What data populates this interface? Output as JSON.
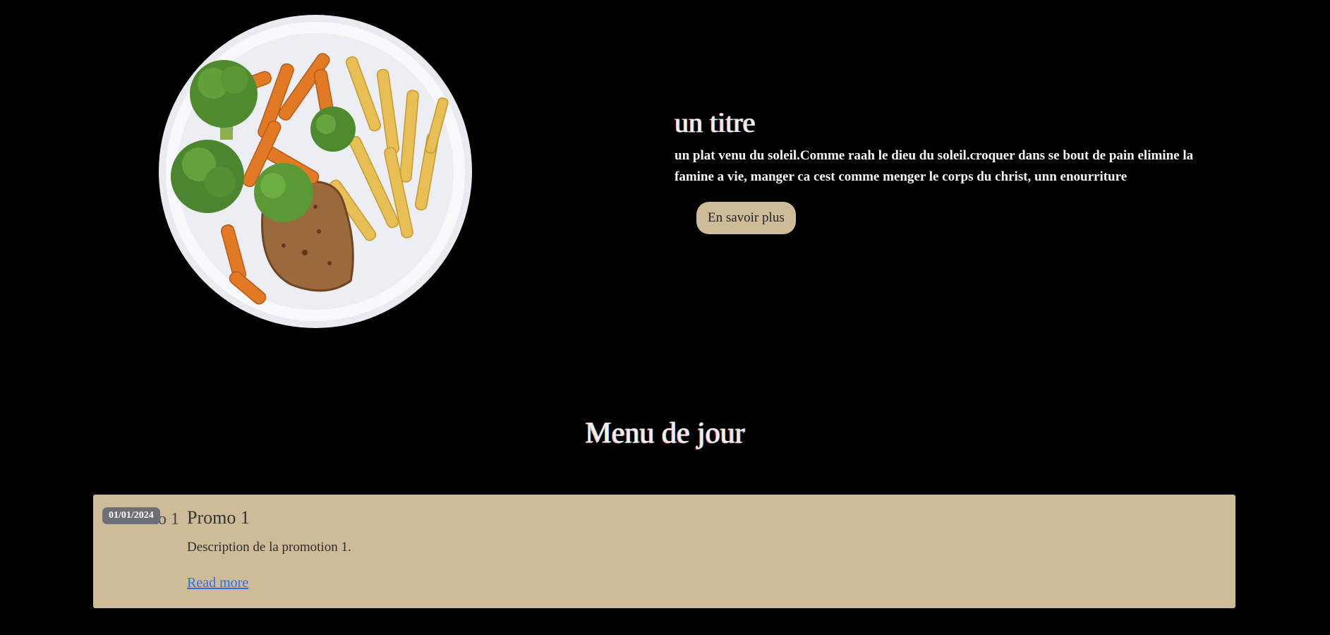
{
  "hero": {
    "title": "un titre",
    "description": "un plat venu du soleil.Comme raah le dieu du soleil.croquer dans se bout de pain elimine la famine a vie, manger ca cest comme menger le corps du christ, unn enourriture",
    "button_label": "En savoir plus",
    "image_icon": "plate-of-food-image"
  },
  "menu_section": {
    "title": "Menu de jour"
  },
  "promo": {
    "ghost_title": "Promo 1",
    "date": "01/01/2024",
    "title": "Promo 1",
    "description": "Description de la promotion 1.",
    "link_label": "Read more"
  },
  "colors": {
    "background": "#000000",
    "accent": "#cebb98",
    "link": "#2a6ff0",
    "badge": "#6c6f75"
  }
}
